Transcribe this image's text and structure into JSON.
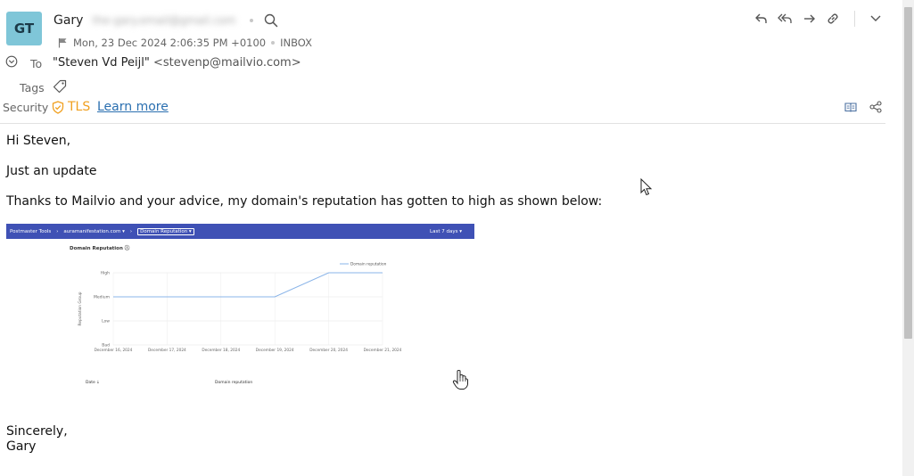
{
  "sender": {
    "initials": "GT",
    "name": "Gary",
    "email_redacted": "the-gary.email@gmail.com"
  },
  "meta": {
    "date": "Mon, 23 Dec 2024 2:06:35 PM +0100",
    "folder": "INBOX"
  },
  "fields": {
    "to_label": "To",
    "to_name": "\"Steven Vd Peijl\"",
    "to_address": "<stevenp@mailvio.com>",
    "tags_label": "Tags",
    "security_label": "Security",
    "security_value": "TLS",
    "learn_more": "Learn more"
  },
  "body": {
    "greeting": "Hi Steven,",
    "line1": "Just an update",
    "line2": "Thanks to Mailvio and your advice, my domain's reputation has gotten to high as shown below:",
    "signoff1": "Sincerely,",
    "signoff2": "Gary"
  },
  "embed": {
    "bar_app": "Postmaster Tools",
    "bar_domain": "auramanifestation.com ▾",
    "bar_chip": "Domain Reputation ▾",
    "bar_range": "Last 7 days ▾",
    "title": "Domain Reputation ⓘ",
    "foot_date": "Date ↓",
    "foot_rep": "Domain reputation"
  },
  "chart_data": {
    "type": "line",
    "title": "Domain Reputation",
    "ylabel": "Reputation Group",
    "categories": [
      "December 16, 2024",
      "December 17, 2024",
      "December 18, 2024",
      "December 19, 2024",
      "December 20, 2024",
      "December 21, 2024"
    ],
    "y_levels": [
      "Bad",
      "Low",
      "Medium",
      "High"
    ],
    "series": [
      {
        "name": "Domain reputation",
        "values": [
          "Medium",
          "Medium",
          "Medium",
          "Medium",
          "High",
          "High"
        ]
      }
    ],
    "colors": {
      "line": "#8ab4e8"
    }
  },
  "icons": {
    "search": "search-icon",
    "flag": "flag-icon",
    "reply": "reply-icon",
    "reply_all": "reply-all-icon",
    "forward": "forward-icon",
    "link": "link-icon",
    "more": "chevron-down-icon",
    "expand": "chevron-circle-icon",
    "tag": "tag-icon",
    "shield": "shield-icon",
    "reader": "reader-view-icon",
    "share": "share-icon"
  }
}
